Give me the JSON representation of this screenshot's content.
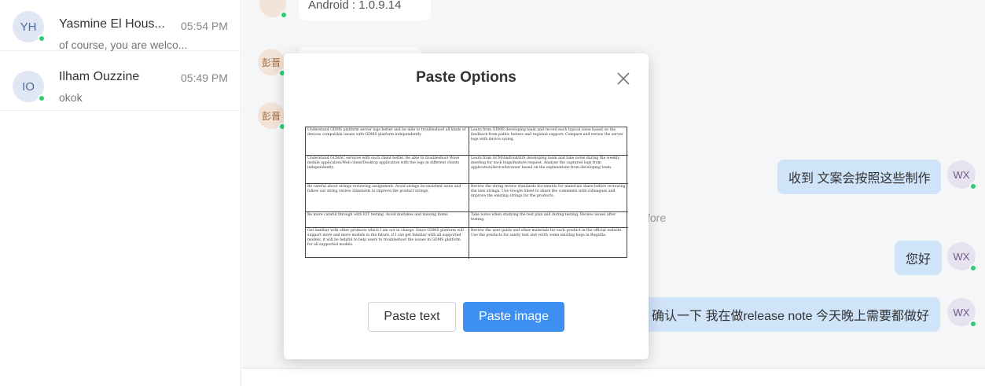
{
  "sidebar": {
    "conversations": [
      {
        "initials": "YH",
        "name": "Yasmine El Hous...",
        "time": "05:54 PM",
        "preview": "of course, you are welco..."
      },
      {
        "initials": "IO",
        "name": "Ilham Ouzzine",
        "time": "05:49 PM",
        "preview": "okok"
      }
    ]
  },
  "chat": {
    "top_message": "Android : 1.0.9.14",
    "left_avatar": "彭晋",
    "my_avatar": "WX",
    "messages_right": [
      "收到 文案会按照这些制作",
      "您好",
      "确认一下 我在做release note 今天晚上需要都做好"
    ],
    "notice_fragment": "fore"
  },
  "modal": {
    "title": "Paste Options",
    "close_label": "×",
    "preview_rows": [
      [
        "Understand GDMS platform server logs better and be able to troubleshoot all kinds of devices compatible issues with GDMS platform independently.",
        "Learn from GDMS developing team and record each typical issue based on the feedback from public testers and regional support. Compare and review the server logs with device syslog."
      ],
      [
        "Understand GCMAC services with each client better. Be able to troubleshoot Wave mobile application/Web client/Desktop application with the logs in different clients independently.",
        "Learn from GCM/Android/iOS developing team and take notes during the weekly meeting for each bugs/feature request. Analyze the captured logs from application/device/browser based on the explanations from developing team."
      ],
      [
        "Be careful about strings reviewing assignment. Avoid strings inconsistent issue and follow our string review standards to improve the product strings.",
        "Review the string review standards documents for materials share before reviewing the new strings. Use Google Sheet to share the comments with colleagues and improve the existing strings for the products."
      ],
      [
        "Be more careful through with IOT testing. Avoid mistakes and missing items.",
        "Take notes when studying the test plan and during testing. Review issues after testing."
      ],
      [
        "Get familiar with other products which I am not in charge. Since GDMS platform will support more and more models in the future, if I can get familiar with all supported models, it will be helpful to help users to troubleshoot the issues in GDMS platform for all supported models.",
        "Review the user guide and other materials for each product in the official website. Use the products for sanity test and verify some existing bugs in Bugzilla."
      ]
    ],
    "paste_text_label": "Paste text",
    "paste_image_label": "Paste image"
  },
  "colors": {
    "primary": "#3d8ff2",
    "bubble_right": "#cfe3f9",
    "online": "#2ecc71"
  }
}
